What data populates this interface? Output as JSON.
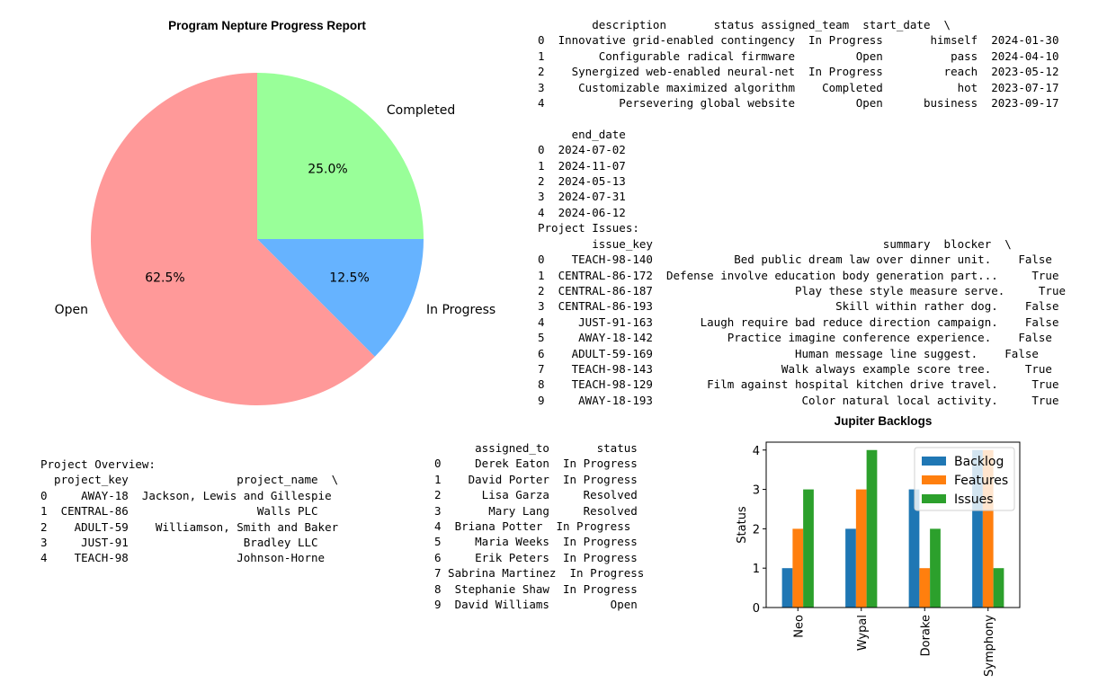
{
  "chart_data": [
    {
      "type": "pie",
      "title": "Program Nepture Progress Report",
      "slices": [
        {
          "label": "Completed",
          "value": 25.0,
          "pct_label": "25.0%",
          "color": "#99ff99"
        },
        {
          "label": "In Progress",
          "value": 12.5,
          "pct_label": "12.5%",
          "color": "#66b3ff"
        },
        {
          "label": "Open",
          "value": 62.5,
          "pct_label": "62.5%",
          "color": "#ff9999"
        }
      ]
    },
    {
      "type": "bar",
      "title": "Jupiter Backlogs",
      "xlabel": "",
      "ylabel": "Status",
      "categories": [
        "Neo",
        "Wypal",
        "Dorake",
        "Symphony"
      ],
      "ylim": [
        0,
        4.2
      ],
      "yticks": [
        "0",
        "1",
        "2",
        "3",
        "4"
      ],
      "legend_position": "top-right",
      "series": [
        {
          "name": "Backlog",
          "values": [
            1,
            2,
            3,
            4
          ],
          "color": "#1f77b4"
        },
        {
          "name": "Features",
          "values": [
            2,
            3,
            1,
            4
          ],
          "color": "#ff7f0e"
        },
        {
          "name": "Issues",
          "values": [
            3,
            4,
            2,
            1
          ],
          "color": "#2ca02c"
        }
      ]
    }
  ],
  "text_blocks": {
    "milestones_table": "        description       status assigned_team  start_date  \\\n0  Innovative grid-enabled contingency  In Progress       himself  2024-01-30   \n1        Configurable radical firmware         Open          pass  2024-04-10   \n2    Synergized web-enabled neural-net  In Progress         reach  2023-05-12   \n3     Customizable maximized algorithm    Completed           hot  2023-07-17   \n4           Persevering global website         Open      business  2023-09-17   \n\n     end_date  \n0  2024-07-02  \n1  2024-11-07  \n2  2024-05-13  \n3  2024-07-31  \n4  2024-06-12  \nProject Issues:\n        issue_key                                  summary  blocker  \\\n0    TEACH-98-140            Bed public dream law over dinner unit.    False   \n1  CENTRAL-86-172  Defense involve education body generation part...     True   \n2  CENTRAL-86-187                     Play these style measure serve.     True   \n3  CENTRAL-86-193                           Skill within rather dog.    False   \n4     JUST-91-163       Laugh require bad reduce direction campaign.    False   \n5     AWAY-18-142           Practice imagine conference experience.    False   \n6    ADULT-59-169                     Human message line suggest.    False   \n7    TEACH-98-143                   Walk always example score tree.     True   \n8    TEACH-98-129        Film against hospital kitchen drive travel.     True   \n9     AWAY-18-193                      Color natural local activity.     True",
    "project_overview": "Project Overview:\n  project_key                project_name  \\\n0     AWAY-18  Jackson, Lewis and Gillespie   \n1  CENTRAL-86                   Walls PLC   \n2    ADULT-59    Williamson, Smith and Baker   \n3     JUST-91                 Bradley LLC   \n4    TEACH-98                Johnson-Horne",
    "assignments": "      assigned_to       status\n0     Derek Eaton  In Progress\n1    David Porter  In Progress\n2      Lisa Garza     Resolved\n3       Mary Lang     Resolved\n4  Briana Potter  In Progress\n5     Maria Weeks  In Progress\n6     Erik Peters  In Progress\n7 Sabrina Martinez  In Progress\n8  Stephanie Shaw  In Progress\n9  David Williams         Open"
  }
}
